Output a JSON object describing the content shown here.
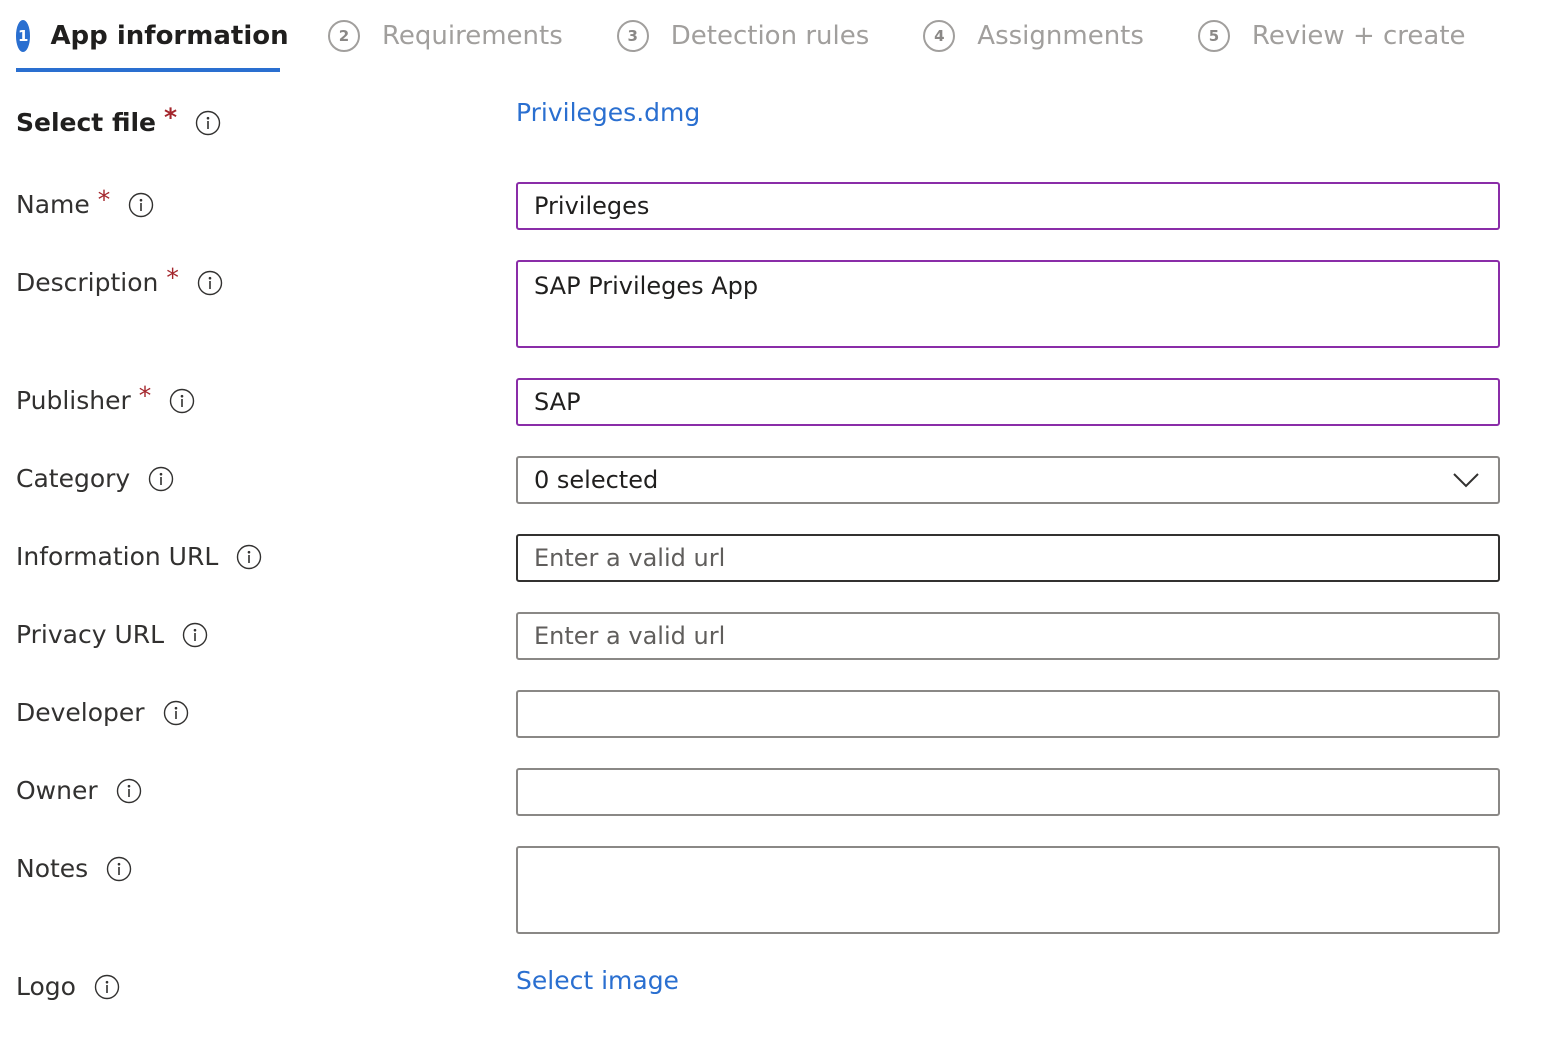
{
  "tabs": [
    {
      "number": "1",
      "label": "App information"
    },
    {
      "number": "2",
      "label": "Requirements"
    },
    {
      "number": "3",
      "label": "Detection rules"
    },
    {
      "number": "4",
      "label": "Assignments"
    },
    {
      "number": "5",
      "label": "Review + create"
    }
  ],
  "form": {
    "select_file": {
      "label": "Select file",
      "required_mark": "*",
      "value": "Privileges.dmg"
    },
    "name": {
      "label": "Name",
      "required_mark": "*",
      "value": "Privileges"
    },
    "description": {
      "label": "Description",
      "required_mark": "*",
      "value": "SAP Privileges App"
    },
    "publisher": {
      "label": "Publisher",
      "required_mark": "*",
      "value": "SAP"
    },
    "category": {
      "label": "Category",
      "value": "0 selected"
    },
    "information_url": {
      "label": "Information URL",
      "value": "",
      "placeholder": "Enter a valid url"
    },
    "privacy_url": {
      "label": "Privacy URL",
      "value": "",
      "placeholder": "Enter a valid url"
    },
    "developer": {
      "label": "Developer",
      "value": ""
    },
    "owner": {
      "label": "Owner",
      "value": ""
    },
    "notes": {
      "label": "Notes",
      "value": ""
    },
    "logo": {
      "label": "Logo",
      "link_text": "Select image"
    }
  },
  "colors": {
    "accent": "#2a6fd0",
    "required": "#a4262c",
    "focus_border": "#8a2da8"
  },
  "icons": {
    "info": "info-circle-icon",
    "dropdown": "chevron-down-icon"
  }
}
